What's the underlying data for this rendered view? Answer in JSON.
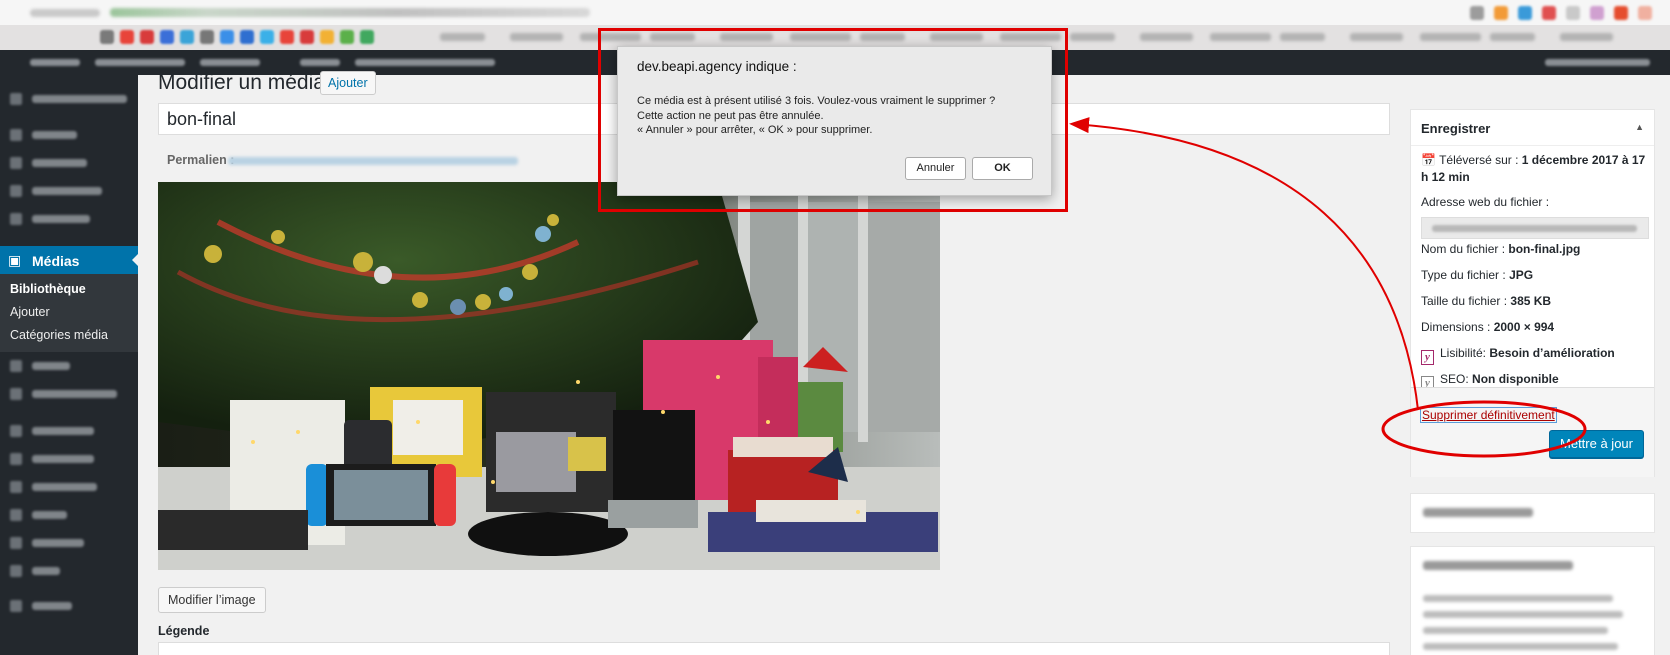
{
  "browser": {
    "extension_colors": [
      "#9c9c9c",
      "#f29b38",
      "#3a9ad9",
      "#e05050",
      "#c9c9c9",
      "#d0a0d0",
      "#e54d2e",
      "#f0b0a0"
    ],
    "bookmark_colors": [
      "#7a7a7a",
      "#e8443a",
      "#d83b3b",
      "#3b6fd8",
      "#3ba4d8",
      "#777777",
      "#3b8fe8",
      "#2f6fd0",
      "#3bb0e8",
      "#e8443a",
      "#d83b3b",
      "#f2b134",
      "#5bb04a",
      "#41a85f"
    ]
  },
  "sidebar": {
    "media_label": "Médias",
    "submenu": {
      "library": "Bibliothèque",
      "add": "Ajouter",
      "categories": "Catégories média"
    }
  },
  "main": {
    "page_title": "Modifier un média",
    "add_button": "Ajouter",
    "title_value": "bon-final",
    "permalink_label": "Permalien :",
    "edit_image_button": "Modifier l’image",
    "legend_label": "Légende"
  },
  "save_panel": {
    "title": "Enregistrer",
    "toggle_icon": "▲",
    "uploaded_label": "Téléversé sur :",
    "uploaded_value": "1 décembre 2017 à 17 h 12 min",
    "file_url_label": "Adresse web du fichier :",
    "filename_label": "Nom du fichier :",
    "filename_value": "bon-final.jpg",
    "filetype_label": "Type du fichier :",
    "filetype_value": "JPG",
    "filesize_label": "Taille du fichier :",
    "filesize_value": "385 KB",
    "dimensions_label": "Dimensions :",
    "dimensions_value": "2000 × 994",
    "readability_label": "Lisibilité:",
    "readability_value": "Besoin d’amélioration",
    "seo_label": "SEO:",
    "seo_value": "Non disponible",
    "delete_link": "Supprimer définitivement",
    "update_button": "Mettre à jour"
  },
  "alert": {
    "title": "dev.beapi.agency indique :",
    "line1": "Ce média est à présent utilisé 3 fois. Voulez-vous vraiment le supprimer ?",
    "line2": "Cette action ne peut pas être annulée.",
    "line3": "« Annuler » pour arrêter, « OK » pour supprimer.",
    "cancel": "Annuler",
    "ok": "OK"
  },
  "annotation_color": "#e00000"
}
